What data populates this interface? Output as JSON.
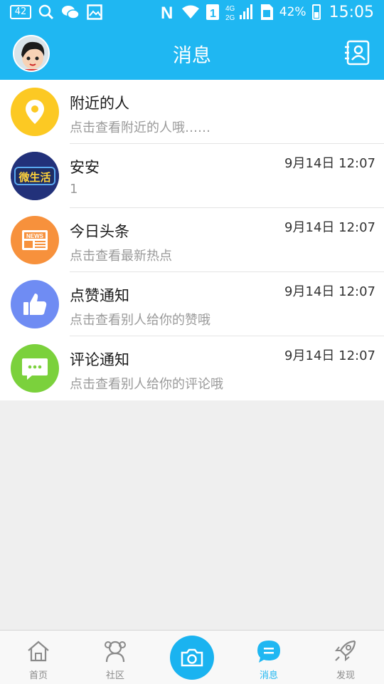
{
  "status_bar": {
    "badge": "42",
    "battery_percent": "42%",
    "time": "15:05",
    "network": "4G\n2G",
    "icons": [
      "badge-icon",
      "search-icon",
      "wechat-icon",
      "gallery-icon",
      "nfc-icon",
      "wifi-icon",
      "sim1-icon",
      "network-4g-icon",
      "signal-icon",
      "sim-card-icon",
      "battery-icon"
    ]
  },
  "header": {
    "title": "消息",
    "colors": {
      "accent": "#1fb7f2"
    }
  },
  "messages": [
    {
      "title": "附近的人",
      "subtitle": "点击查看附近的人哦……",
      "time": "",
      "icon": "location-pin-icon",
      "color": "#fcc923"
    },
    {
      "title": "安安",
      "subtitle": "1",
      "time": "9月14日 12:07",
      "icon": "wei-shenghuo-logo",
      "color": "#22317a",
      "logo_text": "微生活"
    },
    {
      "title": "今日头条",
      "subtitle": "点击查看最新热点",
      "time": "9月14日 12:07",
      "icon": "news-icon",
      "color": "#f7913c",
      "logo_text": "NEWS"
    },
    {
      "title": "点赞通知",
      "subtitle": "点击查看别人给你的赞哦",
      "time": "9月14日 12:07",
      "icon": "thumbs-up-icon",
      "color": "#6f8cf3"
    },
    {
      "title": "评论通知",
      "subtitle": "点击查看别人给你的评论哦",
      "time": "9月14日 12:07",
      "icon": "comment-icon",
      "color": "#7bd13c"
    }
  ],
  "bottom_nav": {
    "tabs": [
      {
        "label": "首页",
        "icon": "home-icon",
        "active": false
      },
      {
        "label": "社区",
        "icon": "community-icon",
        "active": false
      },
      {
        "label": "",
        "icon": "camera-icon",
        "active": false
      },
      {
        "label": "消息",
        "icon": "message-icon",
        "active": true
      },
      {
        "label": "发现",
        "icon": "rocket-icon",
        "active": false
      }
    ]
  }
}
